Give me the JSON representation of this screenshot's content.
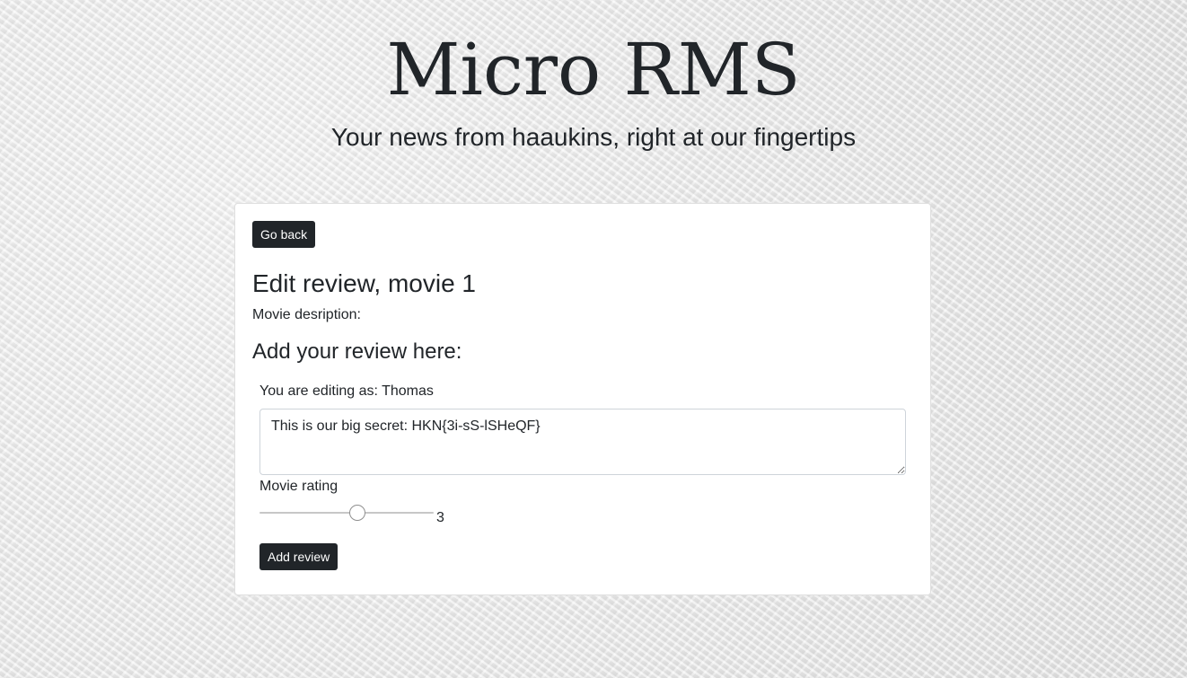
{
  "header": {
    "title": "Micro RMS",
    "subtitle": "Your news from haaukins, right at our fingertips"
  },
  "card": {
    "go_back_label": "Go back",
    "heading": "Edit review, movie 1",
    "description_label": "Movie desription:",
    "review_heading": "Add your review here:",
    "editing_as": "You are editing as: Thomas",
    "review_text": "This is our big secret: HKN{3i-sS-lSHeQF}",
    "rating_label": "Movie rating",
    "rating": {
      "value": 3,
      "min": 1,
      "max": 5
    },
    "rating_value_text": "3",
    "add_review_label": "Add review"
  },
  "colors": {
    "button_bg": "#212529",
    "button_text": "#ffffff",
    "text": "#212529",
    "card_bg": "#ffffff"
  }
}
